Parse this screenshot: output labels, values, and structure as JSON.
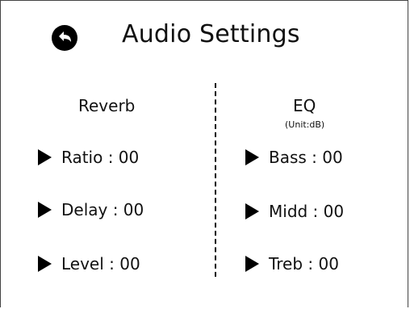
{
  "header": {
    "title": "Audio Settings",
    "back_icon": "back-arrow-icon"
  },
  "reverb": {
    "title": "Reverb",
    "items": [
      {
        "label": "Ratio : 00"
      },
      {
        "label": "Delay : 00"
      },
      {
        "label": "Level : 00"
      }
    ]
  },
  "eq": {
    "title": "EQ",
    "unit": "(Unit:dB)",
    "items": [
      {
        "label": "Bass : 00"
      },
      {
        "label": "Midd : 00"
      },
      {
        "label": "Treb : 00"
      }
    ]
  },
  "colors": {
    "foreground": "#000000",
    "background": "#ffffff"
  }
}
